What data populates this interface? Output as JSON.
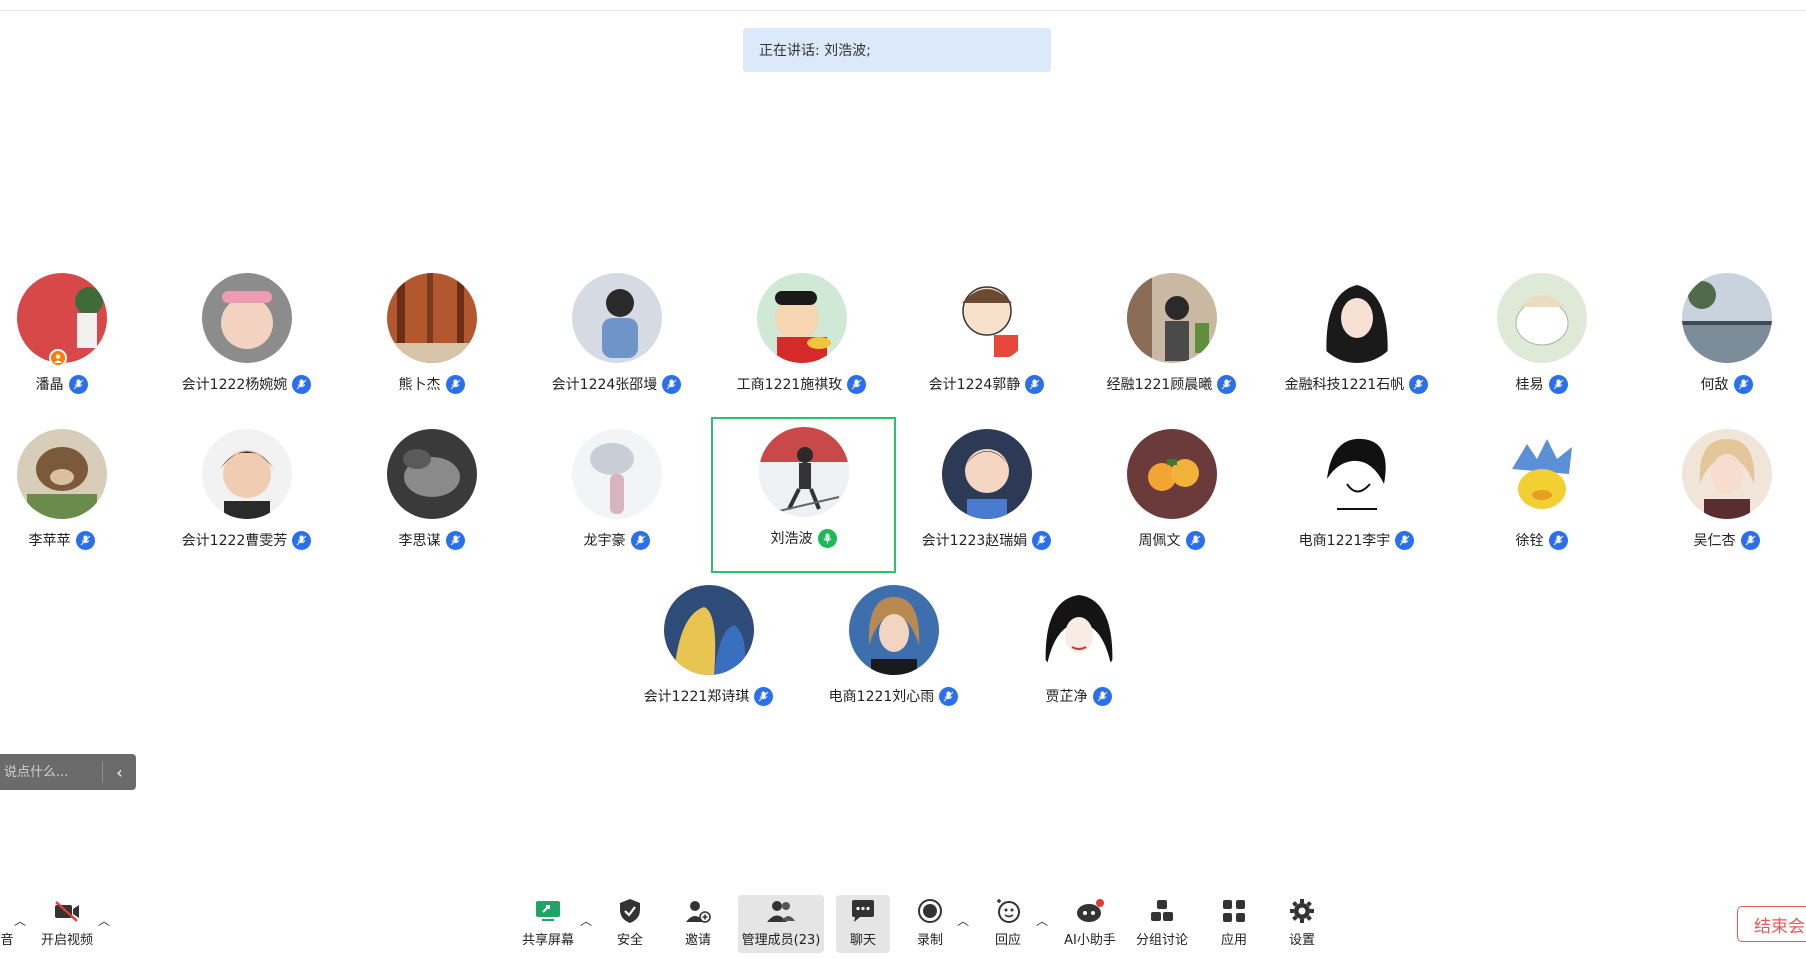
{
  "speaking_banner": "正在讲话: 刘浩波;",
  "participants_row1": [
    {
      "name": "潘晶",
      "host": true
    },
    {
      "name": "会计1222杨婉婉"
    },
    {
      "name": "熊卜杰"
    },
    {
      "name": "会计1224张邵墁"
    },
    {
      "name": "工商1221施祺玫"
    },
    {
      "name": "会计1224郭静"
    },
    {
      "name": "经融1221顾晨曦"
    },
    {
      "name": "金融科技1221石帆"
    },
    {
      "name": "桂易"
    },
    {
      "name": "何敌"
    }
  ],
  "participants_row2": [
    {
      "name": "李苹苹"
    },
    {
      "name": "会计1222曹雯芳"
    },
    {
      "name": "李思谋"
    },
    {
      "name": "龙宇豪"
    },
    {
      "name": "刘浩波",
      "speaking": true
    },
    {
      "name": "会计1223赵瑞娟"
    },
    {
      "name": "周佩文"
    },
    {
      "name": "电商1221李宇"
    },
    {
      "name": "徐铨"
    },
    {
      "name": "吴仁杏"
    }
  ],
  "participants_row3": [
    {
      "name": "会计1221郑诗琪"
    },
    {
      "name": "电商1221刘心雨"
    },
    {
      "name": "贾芷净"
    }
  ],
  "chat": {
    "placeholder": "说点什么...",
    "collapse": "‹"
  },
  "toolbar": {
    "audio_partial": "音",
    "video": "开启视频",
    "share": "共享屏幕",
    "security": "安全",
    "invite": "邀请",
    "members": "管理成员(23)",
    "chat": "聊天",
    "record": "录制",
    "react": "回应",
    "ai": "AI小助手",
    "breakout": "分组讨论",
    "apps": "应用",
    "settings": "设置",
    "end": "结束会"
  },
  "colors": {
    "accent_blue": "#2a6ff0",
    "speaking_green": "#1db954",
    "end_red": "#e25a5a",
    "banner_bg": "#dbe9fb"
  }
}
